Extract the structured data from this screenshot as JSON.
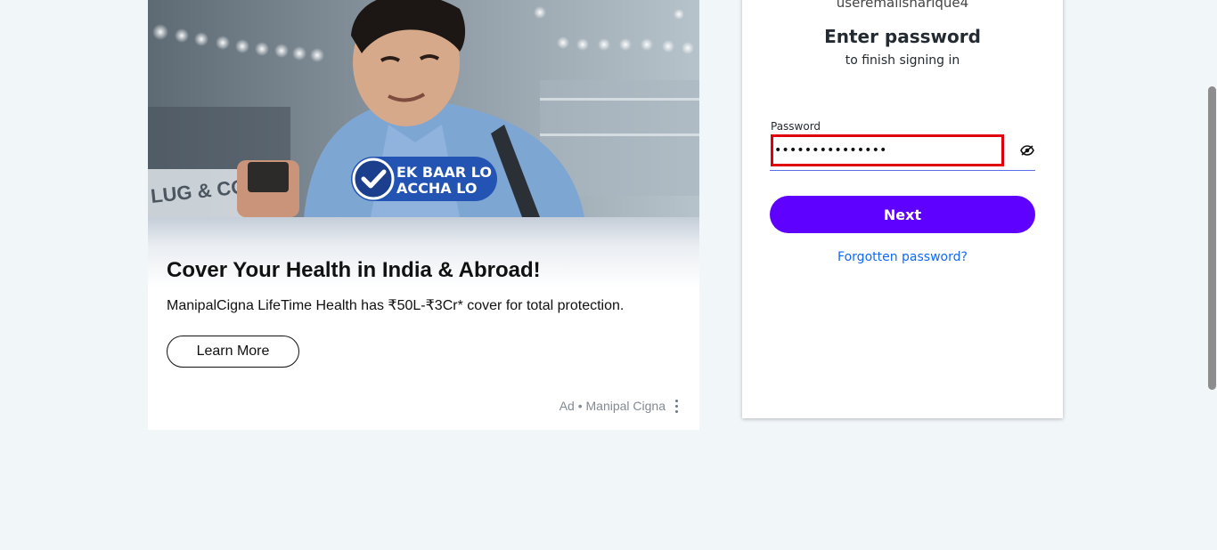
{
  "ad": {
    "badge_line1": "EK BAAR LO",
    "badge_line2": "ACCHA LO",
    "store_sign": "LUG & CON",
    "headline": "Cover Your Health in India & Abroad!",
    "body": "ManipalCigna LifeTime Health has ₹50L-₹3Cr* cover for total protection.",
    "cta_label": "Learn More",
    "footer_label": "Ad • Manipal Cigna",
    "menu_icon": "kebab-vertical-icon"
  },
  "login": {
    "username": "useremailsharique4",
    "title": "Enter password",
    "subtitle": "to finish signing in",
    "password_label": "Password",
    "password_value": "•••••••••••••••",
    "toggle_icon": "eye-slash-icon",
    "next_label": "Next",
    "forgot_label": "Forgotten password?"
  },
  "colors": {
    "page_background": "#f1f6f9",
    "primary_button": "#5f01ff",
    "link": "#0f69ff",
    "highlight_border": "#e0000c"
  }
}
